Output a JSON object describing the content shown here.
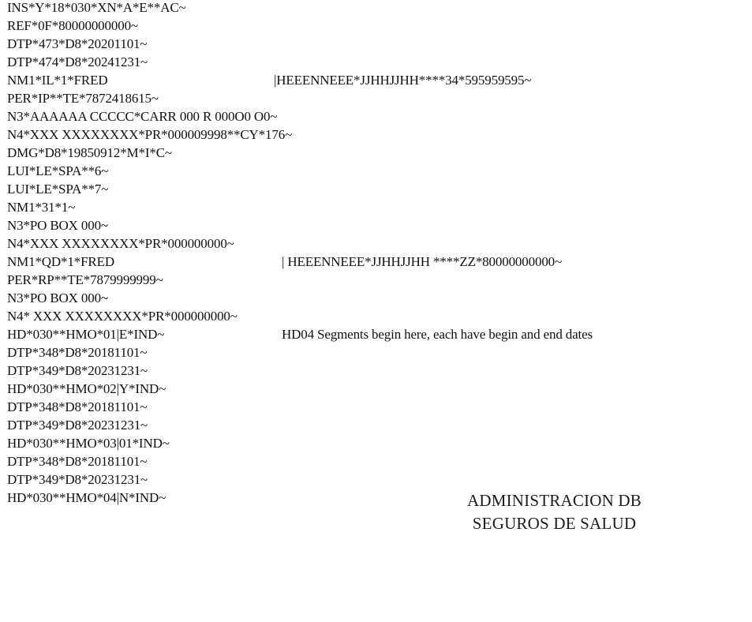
{
  "edi_lines": [
    "INS*Y*18*030*XN*A*E**AC~",
    "REF*0F*80000000000~",
    "DTP*473*D8*20201101~",
    "DTP*474*D8*20241231~",
    "NM1*IL*1*FRED",
    "PER*IP**TE*7872418615~",
    "N3*AAAAAA CCCCC*CARR 000 R 000O0 O0~",
    "N4*XXX XXXXXXXX*PR*000009998**CY*176~",
    "DMG*D8*19850912*M*I*C~",
    "LUI*LE*SPA**6~",
    "LUI*LE*SPA**7~",
    "NM1*31*1~",
    "N3*PO BOX 000~",
    "N4*XXX XXXXXXXX*PR*000000000~",
    "NM1*QD*1*FRED",
    "PER*RP**TE*7879999999~",
    "N3*PO BOX 000~",
    "N4* XXX XXXXXXXX*PR*000000000~",
    "HD*030**HMO*01|E*IND~",
    "DTP*348*D8*20181101~",
    "DTP*349*D8*20231231~",
    "HD*030**HMO*02|Y*IND~",
    "DTP*348*D8*20181101~",
    "DTP*349*D8*20231231~",
    "HD*030**HMO*03|01*IND~",
    "DTP*348*D8*20181101~",
    "DTP*349*D8*20231231~",
    "HD*030**HMO*04|N*IND~"
  ],
  "continuations": {
    "nm1_il_rest": "|HEEENNEEE*JJHHJJHH****34*595959595~",
    "nm1_qd_rest": "| HEEENNEEE*JJHHJJHH ****ZZ*80000000000~"
  },
  "annotation": "HD04 Segments begin here, each have begin and end dates",
  "stamp": {
    "line1": "ADMINISTRACION DB",
    "line2": "SEGUROS DE SALUD"
  }
}
